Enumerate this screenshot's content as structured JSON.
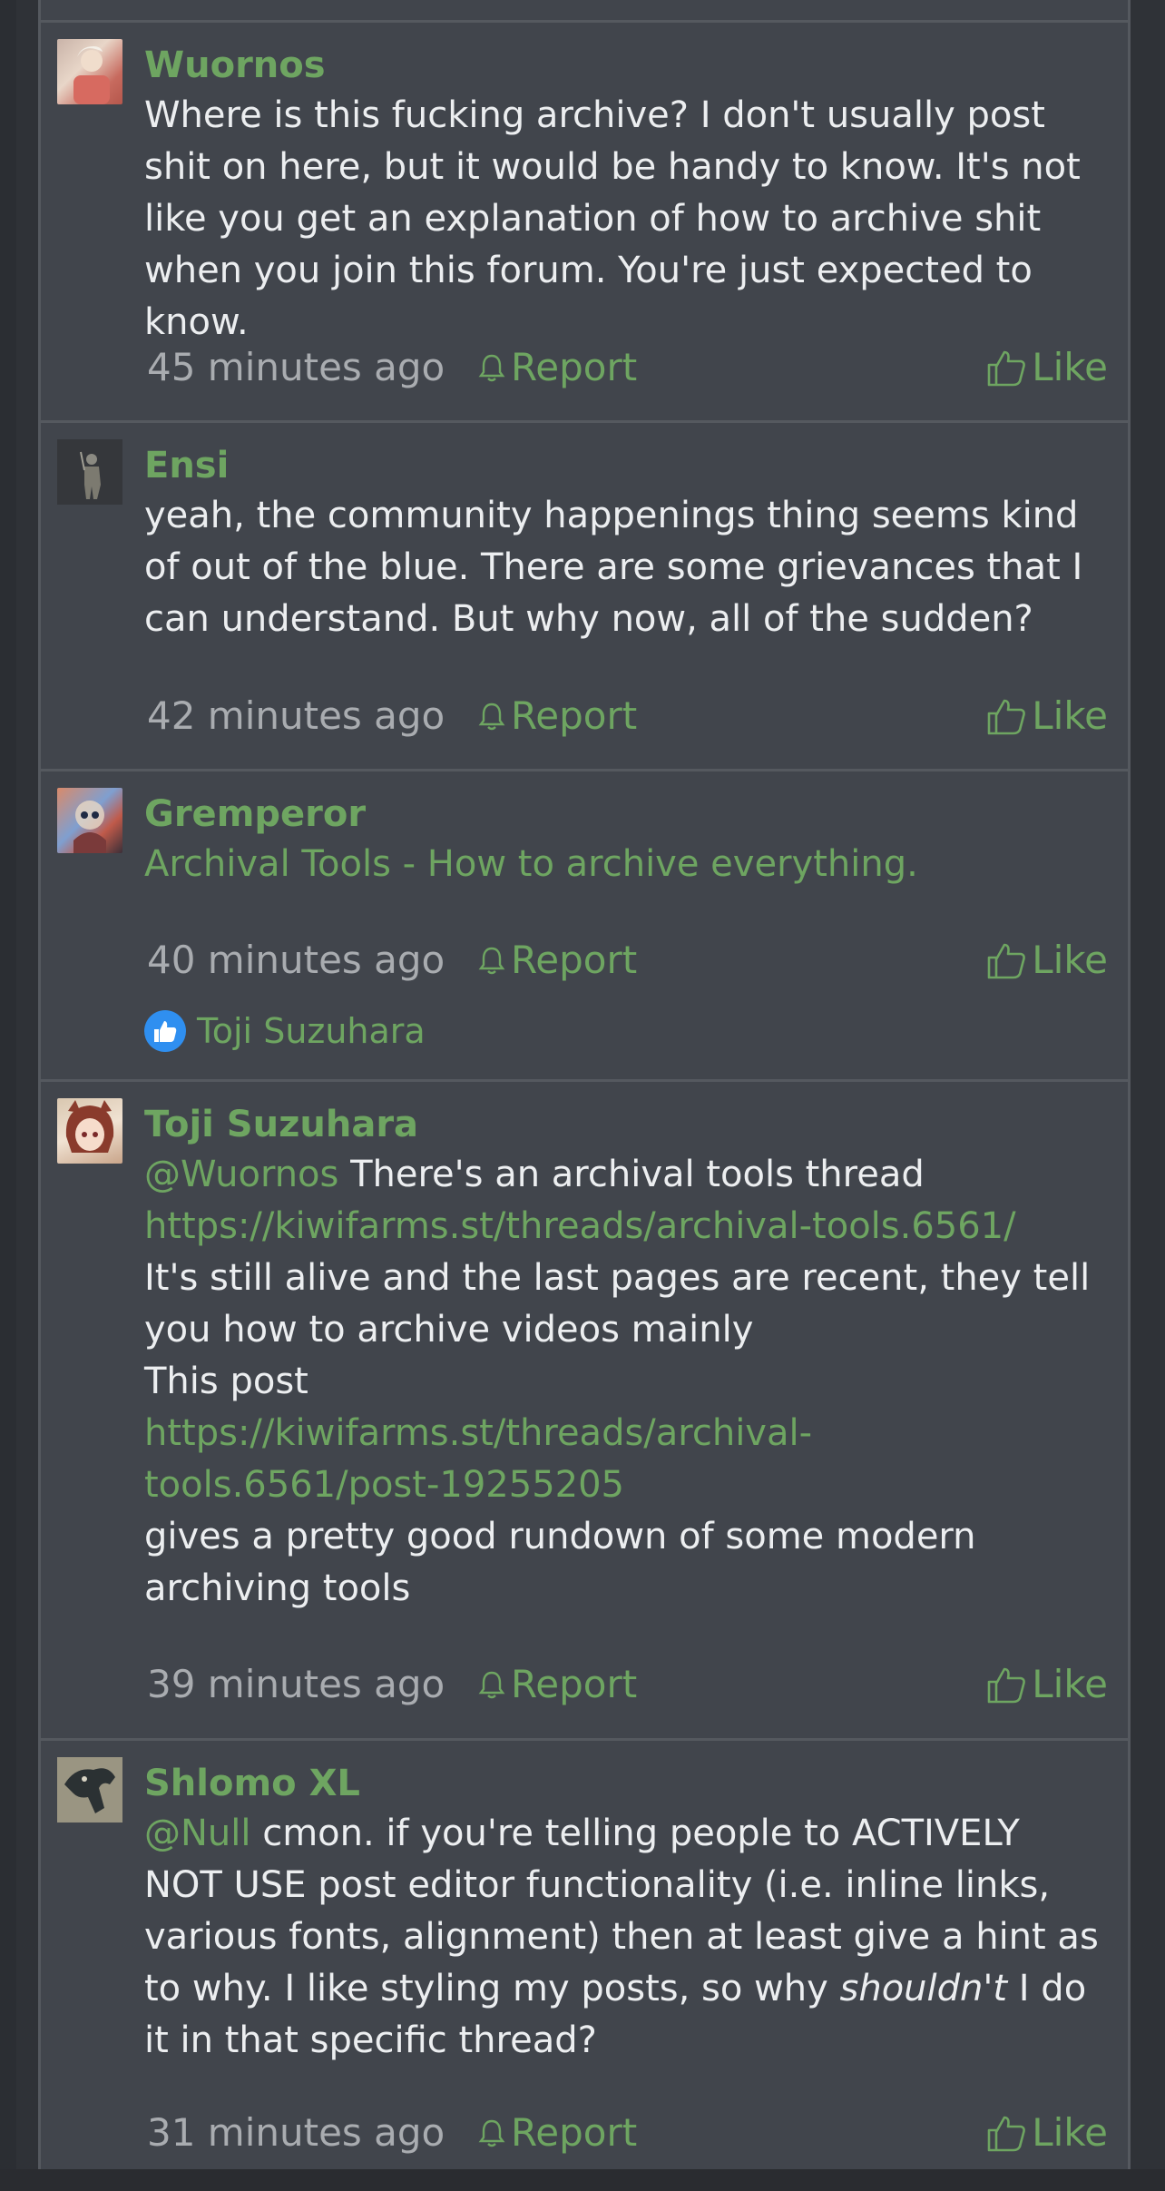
{
  "posts": [
    {
      "author": "Wuornos",
      "avatar": "avatar-wuornos",
      "body": "Where is this fucking archive? I don't usually post shit on here, but it would be handy to know. It's not like you get an explanation of how to archive shit when you join this forum. You're just expected to know.",
      "time": "45 minutes ago",
      "report": "Report",
      "like": "Like"
    },
    {
      "author": "Ensi",
      "avatar": "avatar-ensi",
      "body": "yeah, the community happenings thing seems kind of out of the blue. There are some grievances that I can understand. But why now, all of the sudden?",
      "time": "42 minutes ago",
      "report": "Report",
      "like": "Like"
    },
    {
      "author": "Gremperor",
      "avatar": "avatar-gremperor",
      "link_text": "Archival Tools - How to archive everything.",
      "time": "40 minutes ago",
      "report": "Report",
      "like": "Like",
      "liked_by": "Toji Suzuhara"
    },
    {
      "author": "Toji Suzuhara",
      "avatar": "avatar-toji",
      "mention": "@Wuornos",
      "line1": "There's an archival tools thread",
      "url1": "https://kiwifarms.st/threads/archival-tools.6561/",
      "line2": "It's still alive and the last pages are recent, they tell you how to archive videos mainly",
      "line3": "This post",
      "url2a": "https://kiwifarms.st/threads/archival-",
      "url2b": "tools.6561/post-19255205",
      "line4": "gives a pretty good rundown of some modern archiving tools",
      "time": "39 minutes ago",
      "report": "Report",
      "like": "Like"
    },
    {
      "author": "Shlomo XL",
      "avatar": "avatar-shlomo",
      "mention": "@Null",
      "text_a": "cmon. if you're telling people to ACTIVELY NOT USE post editor functionality (i.e. inline links, various fonts, alignment) then at least give a hint as to why. I like styling my posts, so why",
      "emphasis": "shouldn't",
      "text_b": "I do it in that specific thread?",
      "time": "31 minutes ago",
      "report": "Report",
      "like": "Like"
    }
  ],
  "colors": {
    "accent": "#6ea561",
    "background": "#41454c",
    "text": "#eceef0",
    "muted": "#a9acb0",
    "like_badge": "#2f8ff0"
  }
}
